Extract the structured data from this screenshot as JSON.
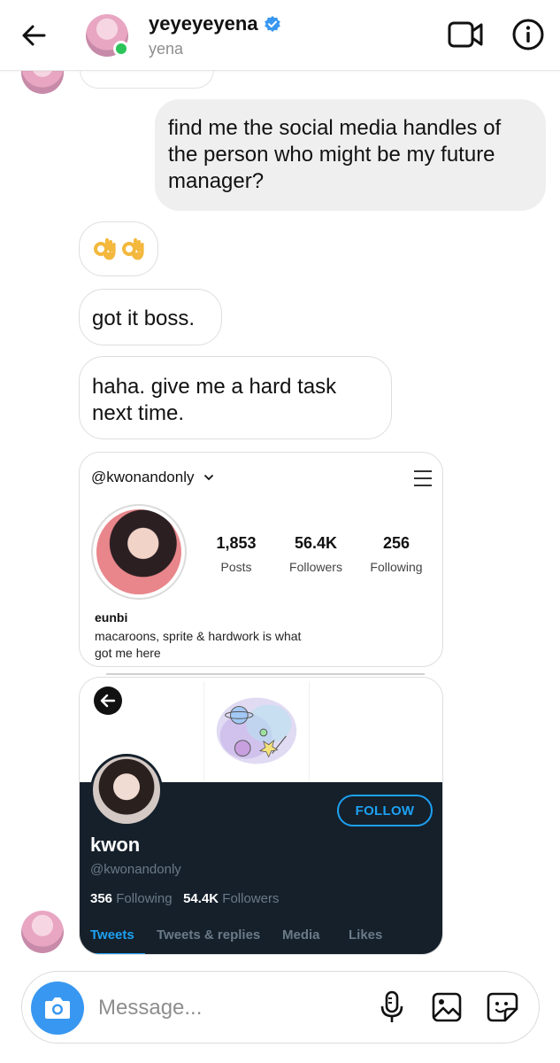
{
  "header": {
    "username": "yeyeyeyena",
    "subtitle": "yena",
    "icons": [
      "back-arrow-icon",
      "verified-badge-icon",
      "video-call-icon",
      "info-icon"
    ]
  },
  "messages": {
    "outgoing_1": "find me the social media handles of the person who might be my future manager?",
    "incoming_ok": "👌👌",
    "incoming_2": "got it boss.",
    "incoming_3": "haha. give me a hard task next time."
  },
  "instagram_card": {
    "handle": "@kwonandonly",
    "stats": [
      {
        "value": "1,853",
        "label": "Posts"
      },
      {
        "value": "56.4K",
        "label": "Followers"
      },
      {
        "value": "256",
        "label": "Following"
      }
    ],
    "name": "eunbi",
    "bio": "macaroons, sprite & hardwork is what got me here"
  },
  "twitter_card": {
    "follow_label": "FOLLOW",
    "name": "kwon",
    "handle": "@kwonandonly",
    "following_count": "356",
    "following_label": "Following",
    "followers_count": "54.4K",
    "followers_label": "Followers",
    "tabs": [
      "Tweets",
      "Tweets & replies",
      "Media",
      "Likes"
    ]
  },
  "composer": {
    "placeholder": "Message..."
  },
  "colors": {
    "accent_blue": "#3897f0",
    "twitter_blue": "#1da1f2",
    "twitter_dark": "#15202b",
    "online_green": "#2cc45a",
    "bubble_gray": "#efefef"
  }
}
